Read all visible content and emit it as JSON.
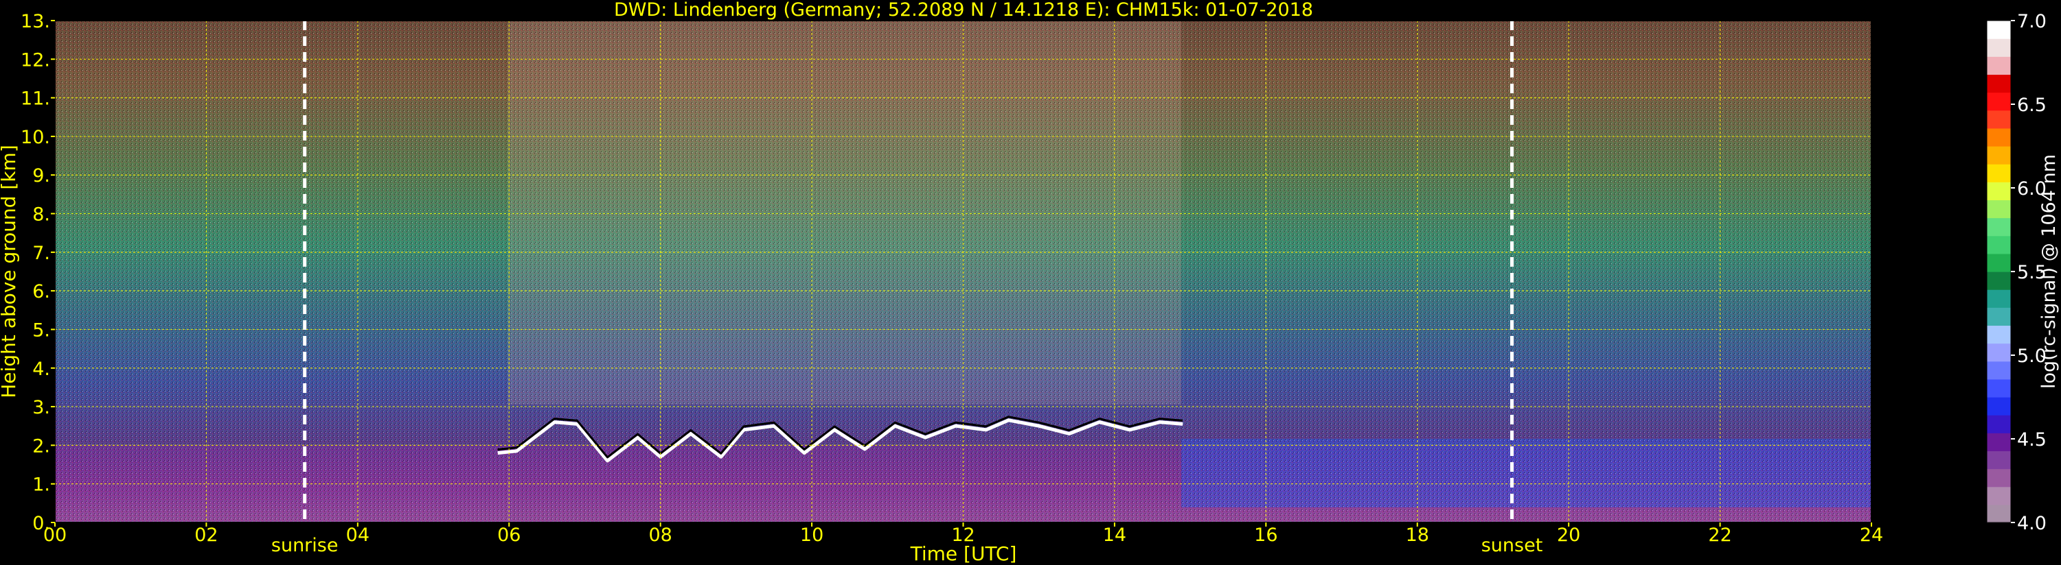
{
  "chart_data": {
    "type": "heatmap",
    "title": "DWD: Lindenberg (Germany; 52.2089 N / 14.1218 E):    CHM15k: 01-07-2018",
    "xlabel": "Time [UTC]",
    "ylabel": "Height above ground [km]",
    "xlim": [
      0,
      24
    ],
    "ylim": [
      0,
      13
    ],
    "x_ticks": [
      0,
      2,
      4,
      6,
      8,
      10,
      12,
      14,
      16,
      18,
      20,
      22,
      24
    ],
    "x_tick_labels": [
      "00",
      "02",
      "04",
      "06",
      "08",
      "10",
      "12",
      "14",
      "16",
      "18",
      "20",
      "22",
      "24"
    ],
    "y_ticks": [
      0,
      1,
      2,
      3,
      4,
      5,
      6,
      7,
      8,
      9,
      10,
      11,
      12,
      13
    ],
    "y_tick_labels": [
      "0.",
      "1.",
      "2.",
      "3.",
      "4.",
      "5.",
      "6.",
      "7.",
      "8.",
      "9.",
      "10.",
      "11.",
      "12.",
      "13."
    ],
    "grid": true,
    "annotations": [
      {
        "label": "sunrise",
        "x": 3.3
      },
      {
        "label": "sunset",
        "x": 19.25
      }
    ],
    "colorbar": {
      "label": "log(rc-signal) @ 1064 nm",
      "range": [
        4.0,
        7.0
      ],
      "ticks": [
        4.0,
        4.5,
        5.0,
        5.5,
        6.0,
        6.5,
        7.0
      ],
      "tick_labels": [
        "4.0",
        "4.5",
        "5.0",
        "5.5",
        "6.0",
        "6.5",
        "7.0"
      ],
      "colors": [
        "#a890a8",
        "#b08ab0",
        "#9a5aa0",
        "#8040a0",
        "#6a1a9a",
        "#3818c8",
        "#2030f0",
        "#4050ff",
        "#6a78ff",
        "#9aa0ff",
        "#a8c8ff",
        "#40b0b0",
        "#20a090",
        "#108040",
        "#20b050",
        "#40d070",
        "#60e080",
        "#a0f060",
        "#e0ff40",
        "#ffe000",
        "#ffb000",
        "#ff8000",
        "#ff4020",
        "#ff1010",
        "#e00000",
        "#f0b0b8",
        "#f0e0e0",
        "#ffffff"
      ]
    },
    "cloud_layer_km": [
      [
        5.85,
        1.8
      ],
      [
        6.1,
        1.85
      ],
      [
        6.6,
        2.6
      ],
      [
        6.9,
        2.55
      ],
      [
        7.3,
        1.6
      ],
      [
        7.7,
        2.2
      ],
      [
        8.0,
        1.7
      ],
      [
        8.4,
        2.3
      ],
      [
        8.8,
        1.7
      ],
      [
        9.1,
        2.4
      ],
      [
        9.5,
        2.5
      ],
      [
        9.9,
        1.8
      ],
      [
        10.3,
        2.4
      ],
      [
        10.7,
        1.9
      ],
      [
        11.1,
        2.5
      ],
      [
        11.5,
        2.2
      ],
      [
        11.9,
        2.5
      ],
      [
        12.3,
        2.4
      ],
      [
        12.6,
        2.65
      ],
      [
        13.0,
        2.5
      ],
      [
        13.4,
        2.3
      ],
      [
        13.8,
        2.6
      ],
      [
        14.2,
        2.4
      ],
      [
        14.6,
        2.6
      ],
      [
        14.9,
        2.55
      ]
    ]
  }
}
